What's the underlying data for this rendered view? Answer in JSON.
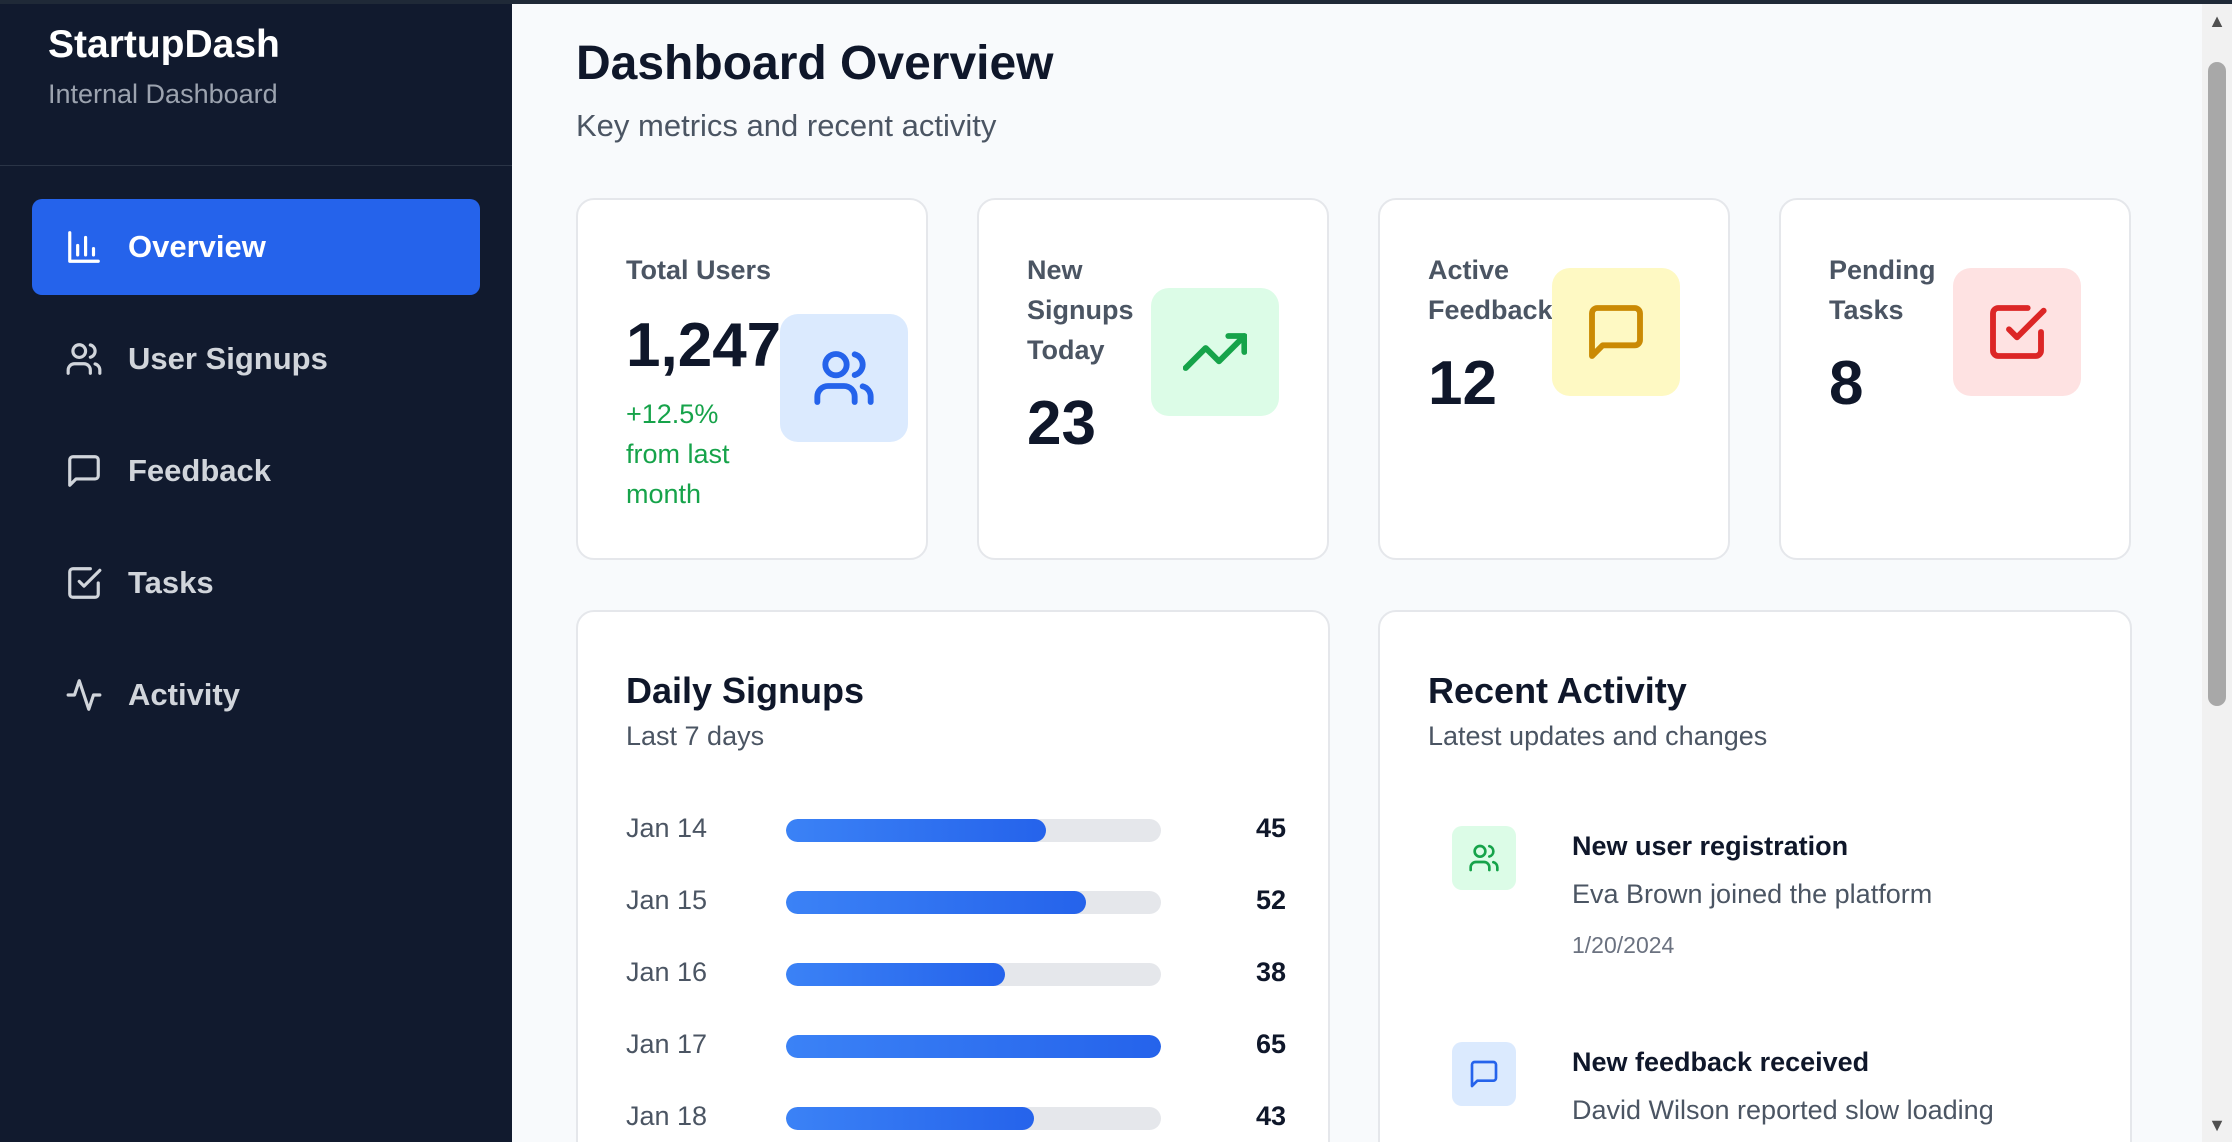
{
  "sidebar": {
    "brand_title": "StartupDash",
    "brand_subtitle": "Internal Dashboard",
    "items": [
      {
        "label": "Overview",
        "icon": "bar-chart-icon",
        "active": true
      },
      {
        "label": "User Signups",
        "icon": "users-icon",
        "active": false
      },
      {
        "label": "Feedback",
        "icon": "message-square-icon",
        "active": false
      },
      {
        "label": "Tasks",
        "icon": "check-square-icon",
        "active": false
      },
      {
        "label": "Activity",
        "icon": "activity-icon",
        "active": false
      }
    ]
  },
  "header": {
    "title": "Dashboard Overview",
    "subtitle": "Key metrics and recent activity"
  },
  "stats": [
    {
      "label": "Total Users",
      "value": "1,247",
      "change": "+12.5% from last month",
      "icon": "users-icon",
      "icon_bg": "#dbeafe",
      "icon_color": "#2563eb"
    },
    {
      "label": "New Signups Today",
      "value": "23",
      "icon": "trending-up-icon",
      "icon_bg": "#dcfce7",
      "icon_color": "#16a34a"
    },
    {
      "label": "Active Feedback",
      "value": "12",
      "icon": "message-square-icon",
      "icon_bg": "#fef9c3",
      "icon_color": "#ca8a04"
    },
    {
      "label": "Pending Tasks",
      "value": "8",
      "icon": "check-square-icon",
      "icon_bg": "#fee2e2",
      "icon_color": "#dc2626"
    }
  ],
  "daily_signups": {
    "title": "Daily Signups",
    "subtitle": "Last 7 days",
    "max": 65,
    "rows": [
      {
        "date": "Jan 14",
        "value": "45"
      },
      {
        "date": "Jan 15",
        "value": "52"
      },
      {
        "date": "Jan 16",
        "value": "38"
      },
      {
        "date": "Jan 17",
        "value": "65"
      },
      {
        "date": "Jan 18",
        "value": "43"
      }
    ]
  },
  "recent_activity": {
    "title": "Recent Activity",
    "subtitle": "Latest updates and changes",
    "items": [
      {
        "title": "New user registration",
        "description": "Eva Brown joined the platform",
        "time": "1/20/2024",
        "icon": "users-icon",
        "icon_bg": "#dcfce7",
        "icon_color": "#16a34a"
      },
      {
        "title": "New feedback received",
        "description": "David Wilson reported slow loading",
        "time": "",
        "icon": "message-square-icon",
        "icon_bg": "#dbeafe",
        "icon_color": "#2563eb"
      }
    ]
  },
  "colors": {
    "sidebar_bg": "#111a2e",
    "accent": "#2563eb",
    "positive": "#16a34a"
  }
}
